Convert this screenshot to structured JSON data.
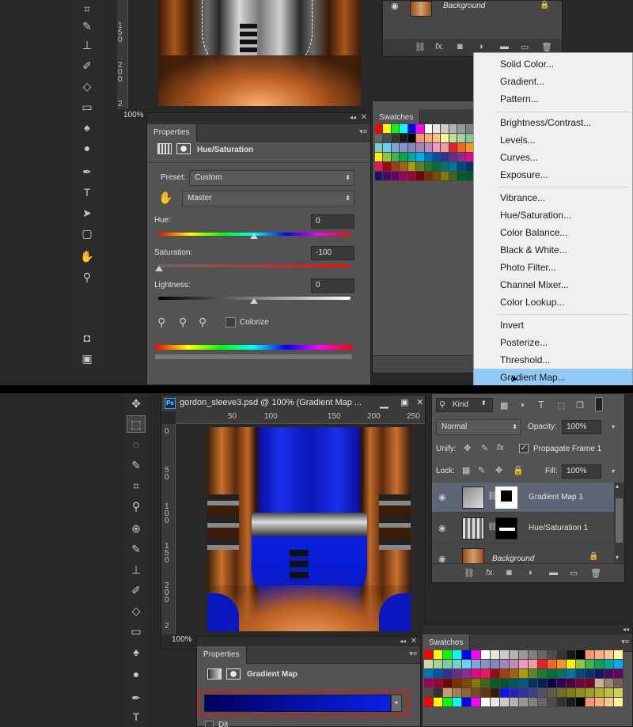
{
  "top_screenshot": {
    "ruler_ticks_v": [
      "1 5 0",
      "2 0 0",
      "2"
    ],
    "zoom": "100%",
    "layers": {
      "background_name": "Background"
    },
    "properties": {
      "tab": "Properties",
      "title": "Hue/Saturation",
      "preset_label": "Preset:",
      "preset_value": "Custom",
      "channel_value": "Master",
      "hue_label": "Hue:",
      "hue_value": "0",
      "saturation_label": "Saturation:",
      "saturation_value": "-100",
      "lightness_label": "Lightness:",
      "lightness_value": "0",
      "colorize_label": "Colorize"
    },
    "swatches_tab": "Swatches",
    "adjust_menu": {
      "group1": [
        "Solid Color...",
        "Gradient...",
        "Pattern..."
      ],
      "group2": [
        "Brightness/Contrast...",
        "Levels...",
        "Curves...",
        "Exposure..."
      ],
      "group3": [
        "Vibrance...",
        "Hue/Saturation...",
        "Color Balance...",
        "Black & White...",
        "Photo Filter...",
        "Channel Mixer...",
        "Color Lookup..."
      ],
      "group4": [
        "Invert",
        "Posterize...",
        "Threshold...",
        "Gradient Map..."
      ],
      "highlight_color": "#91c9f7"
    }
  },
  "bottom_screenshot": {
    "doc_title": "gordon_sleeve3.psd @ 100% (Gradient Map ...",
    "ps_badge": "Ps",
    "ruler_h": [
      "50",
      "100",
      "150",
      "200",
      "250"
    ],
    "ruler_v": [
      "0",
      "5 0",
      "1 0 0",
      "1 5 0",
      "2 0 0",
      "2"
    ],
    "zoom": "100%",
    "layers": {
      "kind_label": "Kind",
      "blend_mode": "Normal",
      "opacity_label": "Opacity:",
      "opacity_value": "100%",
      "unify_label": "Unify:",
      "propagate_label": "Propagate Frame 1",
      "lock_label": "Lock:",
      "fill_label": "Fill:",
      "fill_value": "100%",
      "items": [
        "Gradient Map 1",
        "Hue/Saturation 1",
        "Background"
      ]
    },
    "swatches_tab": "Swatches",
    "properties": {
      "tab": "Properties",
      "title": "Gradient Map",
      "dither_partial": "Dit"
    }
  },
  "colors": {
    "accent_blue": "#0a1adb",
    "gradient_dark": "#000060",
    "gradient_bright": "#0a20e8",
    "highlight_red": "#d11c1c"
  }
}
